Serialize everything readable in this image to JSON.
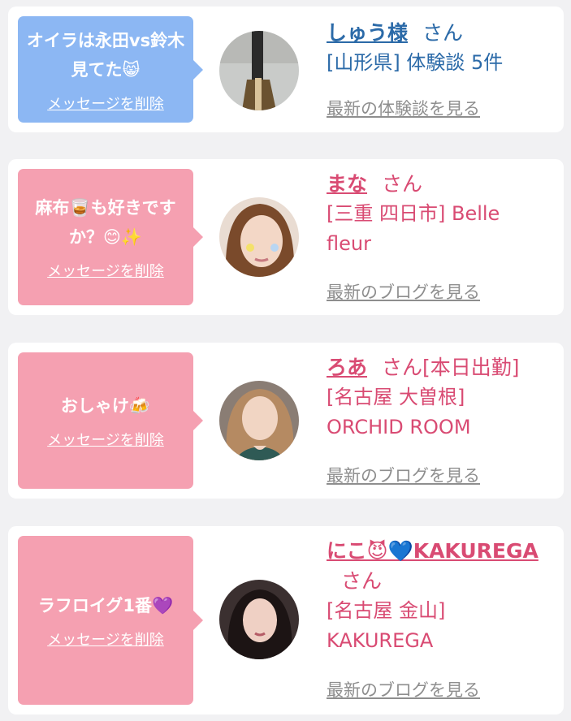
{
  "cards": [
    {
      "message": "オイラは永田vs鈴木見てた😸",
      "delete_label": "メッセージを削除",
      "name": "しゅう様",
      "suffix": "さん",
      "location": "[山形県] 体験談 5件",
      "link": "最新の体験談を見る",
      "theme": "blue"
    },
    {
      "message": "麻布🥃も好きですか？😊✨",
      "delete_label": "メッセージを削除",
      "name": "まな",
      "suffix": "さん",
      "location": "[三重 四日市] Belle fleur",
      "link": "最新のブログを見る",
      "theme": "pink"
    },
    {
      "message": "おしゃけ🍻",
      "delete_label": "メッセージを削除",
      "name": "ろあ",
      "suffix": "さん[本日出勤]",
      "location": "[名古屋 大曽根] ORCHID ROOM",
      "link": "最新のブログを見る",
      "theme": "pink"
    },
    {
      "message": "ラフロイグ1番💜",
      "delete_label": "メッセージを削除",
      "name": "にこ😈💙KAKUREGA",
      "suffix": "さん",
      "location": "[名古屋 金山] KAKUREGA",
      "link": "最新のブログを見る",
      "theme": "pink"
    }
  ],
  "colors": {
    "blue": "#8cb7f3",
    "pink": "#f5a0b1",
    "blue_text": "#2b6aa8",
    "pink_text": "#d94b73"
  }
}
